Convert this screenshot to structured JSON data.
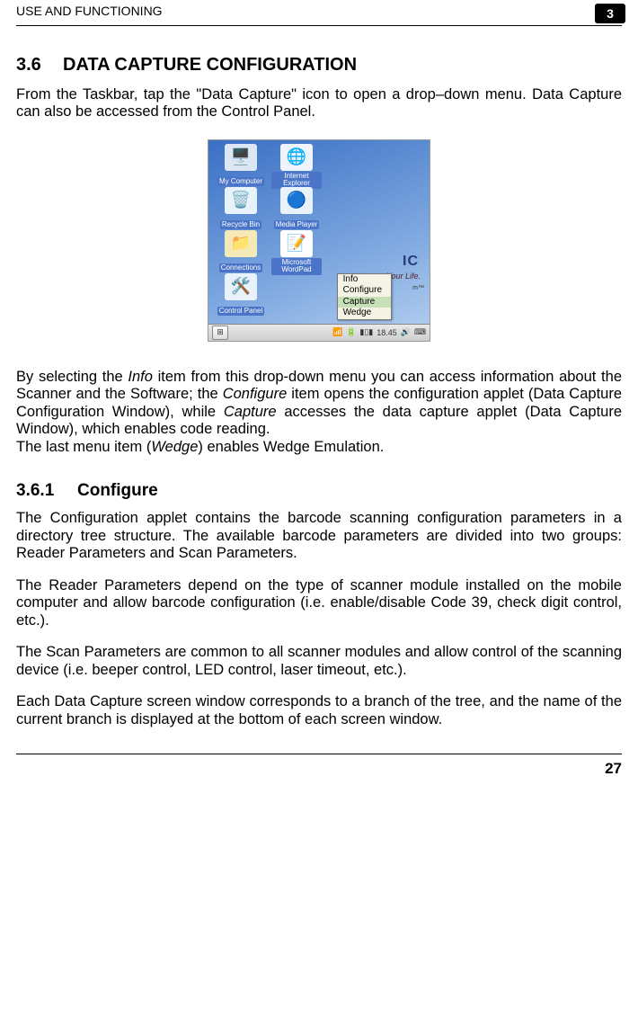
{
  "header": {
    "running_head": "USE AND FUNCTIONING",
    "chapter_number": "3"
  },
  "section": {
    "number": "3.6",
    "title": "DATA CAPTURE CONFIGURATION"
  },
  "para1": "From the Taskbar, tap the \"Data Capture\" icon to open a drop–down menu. Data Capture can also be accessed from the Control Panel.",
  "screenshot": {
    "icons": {
      "my_computer": "My Computer",
      "internet_explorer": "Internet Explorer",
      "recycle_bin": "Recycle Bin",
      "media_player": "Media Player",
      "connections": "Connections",
      "microsoft_wordpad": "Microsoft WordPad",
      "control_panel": "Control Panel"
    },
    "popup_items": [
      "Info",
      "Configure",
      "Capture",
      "Wedge"
    ],
    "popup_highlight_index": 2,
    "background_brand": "IC",
    "background_tagline_left": "Your Life.",
    "background_tagline_right": "m",
    "tm": "™",
    "taskbar": {
      "time": "18.45"
    }
  },
  "para2_a": "By selecting the ",
  "para2_b": "Info",
  "para2_c": " item from this drop-down menu you can access information about the Scanner and the Software; the ",
  "para2_d": "Configure",
  "para2_e": " item opens the configuration applet (Data Capture Configuration Window), while ",
  "para2_f": "Capture",
  "para2_g": " accesses the data capture applet (Data Capture Window), which enables code reading.",
  "para2_line2_a": "The last menu item (",
  "para2_line2_b": "Wedge",
  "para2_line2_c": ") enables Wedge Emulation.",
  "subsection": {
    "number": "3.6.1",
    "title": "Configure"
  },
  "para3": "The Configuration applet contains the barcode scanning configuration parameters in a directory tree structure. The available barcode parameters are divided into two groups: Reader Parameters and Scan Parameters.",
  "para4": "The Reader Parameters depend on the type of scanner module installed on the mobile computer and allow barcode configuration (i.e. enable/disable Code 39, check digit control, etc.).",
  "para5": "The Scan Parameters are common to all scanner modules and allow control of the scanning device (i.e. beeper control, LED control, laser timeout, etc.).",
  "para6": "Each Data Capture screen window corresponds to a branch of the tree, and the name of the current branch is displayed at the bottom of each screen window.",
  "footer": {
    "page_number": "27"
  }
}
